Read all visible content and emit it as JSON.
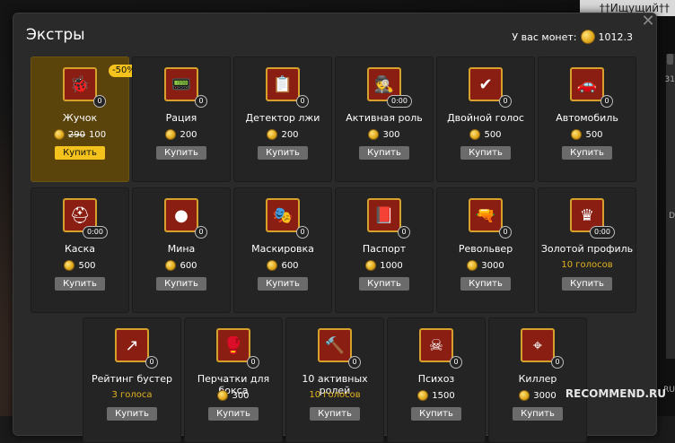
{
  "topbar": {
    "label": "††Ищущий††"
  },
  "side_labels": {
    "a": "31",
    "b": "D",
    "c": "RU"
  },
  "dialog": {
    "title": "Экстры",
    "coins_label": "У вас монет:",
    "coins_value": "1012.3"
  },
  "cards": [
    {
      "name": "Жучок",
      "old_price": "290",
      "price": "100",
      "buy": "Купить",
      "count": "0",
      "badge": "-50%",
      "icon": "bug-icon",
      "glyph": "🐞"
    },
    {
      "name": "Рация",
      "price": "200",
      "buy": "Купить",
      "count": "0",
      "icon": "radio-icon",
      "glyph": "📟"
    },
    {
      "name": "Детектор лжи",
      "price": "200",
      "buy": "Купить",
      "count": "0",
      "icon": "lie-detector-icon",
      "glyph": "📋"
    },
    {
      "name": "Активная роль",
      "price": "300",
      "buy": "Купить",
      "count": "0:00",
      "icon": "active-role-icon",
      "glyph": "🕵"
    },
    {
      "name": "Двойной голос",
      "price": "500",
      "buy": "Купить",
      "count": "0",
      "icon": "double-vote-icon",
      "glyph": "✔"
    },
    {
      "name": "Автомобиль",
      "price": "500",
      "buy": "Купить",
      "count": "0",
      "icon": "car-icon",
      "glyph": "🚗"
    },
    {
      "name": "Каска",
      "price": "500",
      "buy": "Купить",
      "count": "0:00",
      "icon": "helmet-icon",
      "glyph": "⛑"
    },
    {
      "name": "Мина",
      "price": "600",
      "buy": "Купить",
      "count": "0",
      "icon": "mine-icon",
      "glyph": "●"
    },
    {
      "name": "Маскировка",
      "price": "600",
      "buy": "Купить",
      "count": "0",
      "icon": "mask-icon",
      "glyph": "🎭"
    },
    {
      "name": "Паспорт",
      "price": "1000",
      "buy": "Купить",
      "count": "0",
      "icon": "passport-icon",
      "glyph": "📕"
    },
    {
      "name": "Револьвер",
      "price": "3000",
      "buy": "Купить",
      "count": "0",
      "icon": "revolver-icon",
      "glyph": "🔫"
    },
    {
      "name": "Золотой профиль",
      "votes": "10 голосов",
      "buy": "Купить",
      "count": "0:00",
      "icon": "crown-icon",
      "glyph": "♛"
    },
    {
      "name": "Рейтинг бустер",
      "votes": "3 голоса",
      "buy": "Купить",
      "count": "0",
      "icon": "arrow-icon",
      "glyph": "↗"
    },
    {
      "name": "Перчатки для бокса",
      "price": "300",
      "buy": "Купить",
      "count": "0",
      "icon": "boxing-gloves-icon",
      "glyph": "🥊"
    },
    {
      "name": "10 активных ролей",
      "votes": "10 голосов",
      "buy": "Купить",
      "count": "0",
      "icon": "gavel-icon",
      "glyph": "🔨"
    },
    {
      "name": "Психоз",
      "price": "1500",
      "buy": "Купить",
      "count": "0",
      "icon": "psycho-mask-icon",
      "glyph": "☠"
    },
    {
      "name": "Киллер",
      "price": "3000",
      "buy": "Купить",
      "count": "0",
      "icon": "target-icon",
      "glyph": "⌖"
    }
  ],
  "watermark": "RECOMMEND.RU"
}
